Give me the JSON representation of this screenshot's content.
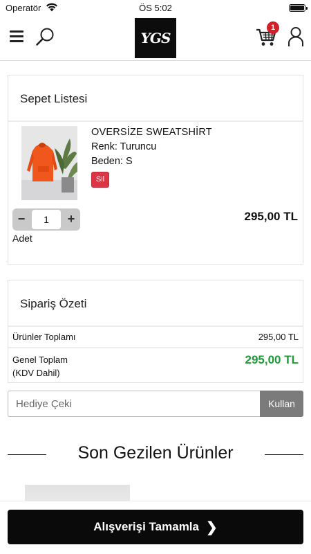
{
  "status_bar": {
    "carrier": "Operatör",
    "time": "ÖS 5:02"
  },
  "header": {
    "logo_text": "YGS",
    "cart_count": "1"
  },
  "cart": {
    "title": "Sepet Listesi",
    "item": {
      "name": "OVERSİZE SWEATSHİRT",
      "color": "Renk: Turuncu",
      "size": "Beden: S",
      "delete_label": "Sil",
      "quantity": "1",
      "quantity_label": "Adet",
      "price": "295,00 TL",
      "minus": "−",
      "plus": "+"
    }
  },
  "summary": {
    "title": "Sipariş Özeti",
    "subtotal_label": "Ürünler Toplamı",
    "subtotal_value": "295,00 TL",
    "total_label_line1": "Genel Toplam",
    "total_label_line2": "(KDV Dahil)",
    "total_value": "295,00 TL",
    "total_color": "#1f9a38"
  },
  "gift": {
    "placeholder": "Hediye Çeki",
    "button_label": "Kullan"
  },
  "recent": {
    "title": "Son Gezilen Ürünler"
  },
  "checkout": {
    "label": "Alışverişi Tamamla",
    "chevron": "❯"
  },
  "colors": {
    "delete": "#dc3545",
    "badge": "#d0202a",
    "checkout_bg": "#0a0a0a",
    "apply_bg": "#7b7b7b"
  }
}
